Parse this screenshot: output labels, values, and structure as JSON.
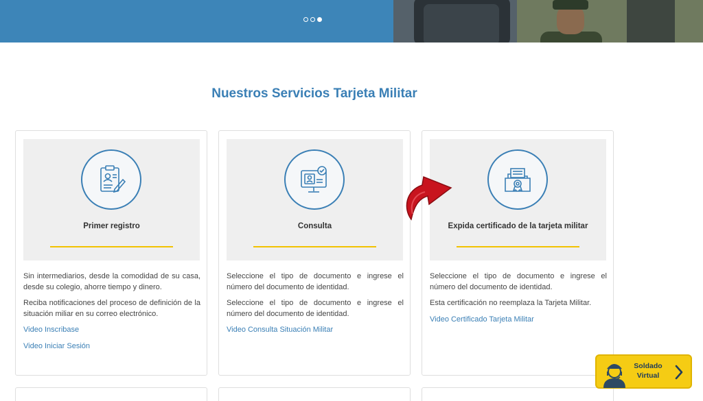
{
  "carousel": {
    "slide_count": 3,
    "active_slide": 3
  },
  "section": {
    "title": "Nuestros Servicios Tarjeta Militar"
  },
  "cards": [
    {
      "title": "Primer registro",
      "icon": "clipboard-pen-icon",
      "paragraphs": [
        "Sin intermediarios, desde la comodidad de su casa, desde su colegio, ahorre tiempo y dinero.",
        "Reciba notificaciones del proceso de definición de la situación miliar en su correo electrónico."
      ],
      "links": [
        "Video Inscribase",
        "Video Iniciar Sesión"
      ]
    },
    {
      "title": "Consulta",
      "icon": "monitor-id-check-icon",
      "paragraphs": [
        "Seleccione el tipo de documento e ingrese el número del documento de identidad.",
        "Seleccione el tipo de documento e ingrese el número del documento de identidad."
      ],
      "links": [
        "Video Consulta Situación Militar"
      ]
    },
    {
      "title": "Expida certificado de la tarjeta militar",
      "icon": "certificate-folder-icon",
      "paragraphs": [
        "Seleccione el tipo de documento e ingrese el número del documento de identidad.",
        "Esta certificación no reemplaza la Tarjeta Militar."
      ],
      "links": [
        "Video Certificado Tarjeta Militar"
      ]
    }
  ],
  "soldado_virtual": {
    "line1": "Soldado",
    "line2": "Virtual",
    "icon": "soldier-avatar-icon"
  },
  "colors": {
    "brand_blue": "#3a7fb5",
    "banner_blue": "#3d85b8",
    "accent_yellow": "#f2c200",
    "arrow_red": "#c8141e"
  }
}
